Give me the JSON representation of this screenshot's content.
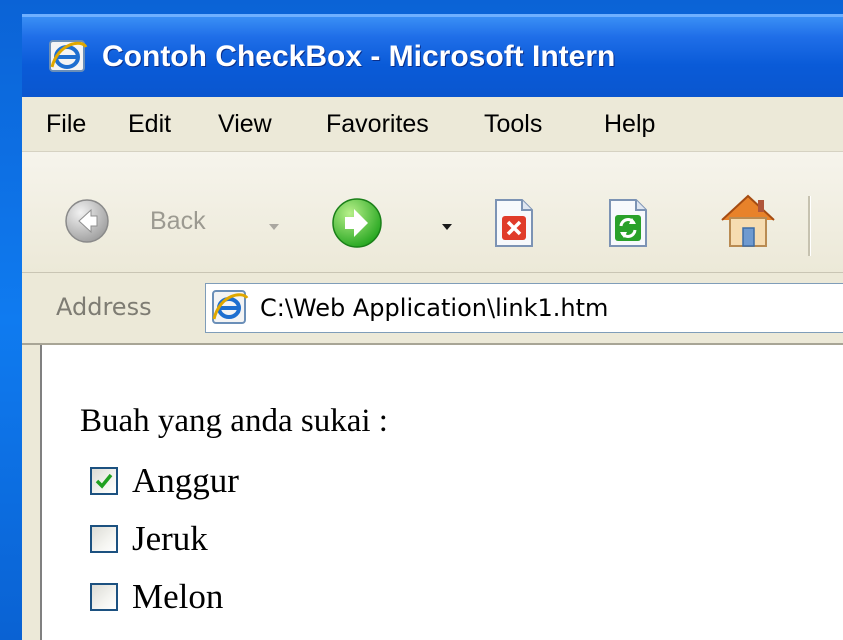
{
  "window": {
    "title": "Contoh CheckBox - Microsoft Intern"
  },
  "menu": {
    "items": [
      "File",
      "Edit",
      "View",
      "Favorites",
      "Tools",
      "Help"
    ]
  },
  "toolbar": {
    "back_label": "Back",
    "icons": [
      "back-icon",
      "forward-icon",
      "stop-icon",
      "refresh-icon",
      "home-icon"
    ]
  },
  "address": {
    "label": "Address",
    "url": "C:\\Web Application\\link1.htm"
  },
  "page": {
    "heading": "Buah yang anda sukai :",
    "checkboxes": [
      {
        "label": "Anggur",
        "checked": true
      },
      {
        "label": "Jeruk",
        "checked": false
      },
      {
        "label": "Melon",
        "checked": false
      }
    ]
  },
  "colors": {
    "titlebar": "#0a5bd8",
    "background": "#0a6ee8",
    "check": "#21a121"
  }
}
